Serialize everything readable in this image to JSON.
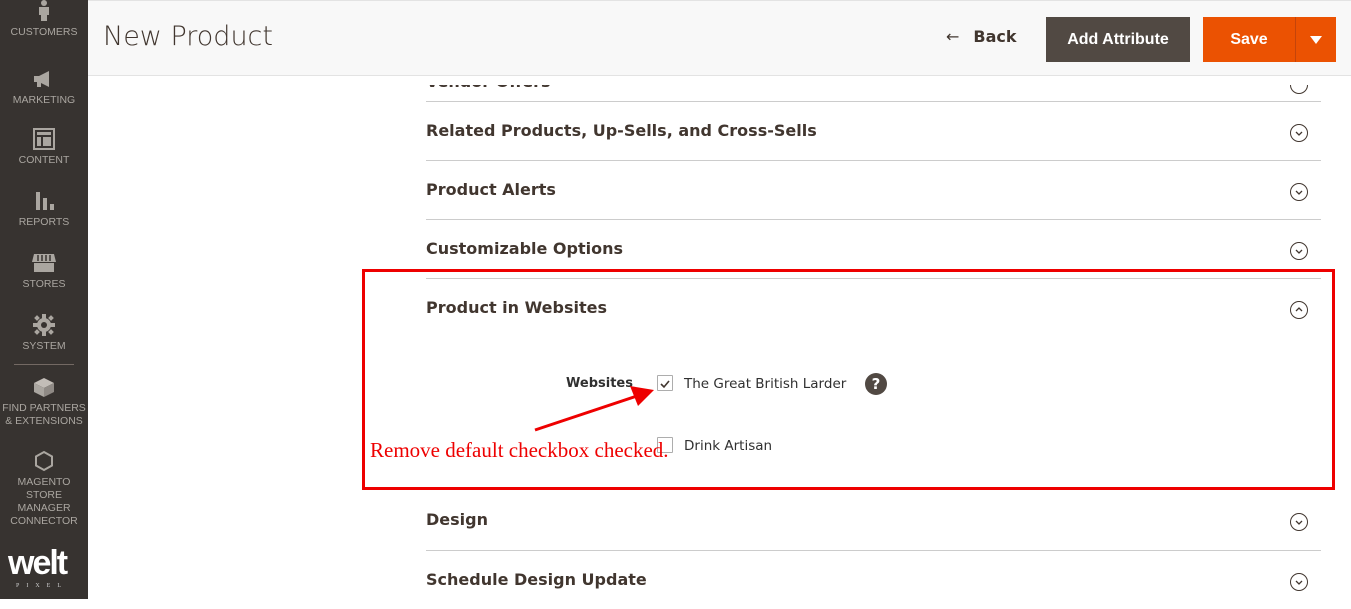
{
  "sidebar": {
    "items": [
      {
        "label": "CUSTOMERS",
        "icon": "customers-icon"
      },
      {
        "label": "MARKETING",
        "icon": "megaphone-icon"
      },
      {
        "label": "CONTENT",
        "icon": "content-icon"
      },
      {
        "label": "REPORTS",
        "icon": "reports-icon"
      },
      {
        "label": "STORES",
        "icon": "store-icon"
      },
      {
        "label": "SYSTEM",
        "icon": "gear-icon"
      },
      {
        "label": "FIND PARTNERS & EXTENSIONS",
        "icon": "brick-icon"
      },
      {
        "label": "MAGENTO STORE MANAGER CONNECTOR",
        "icon": "hexagon-icon"
      }
    ],
    "logo": "welt",
    "logo_sub": "PIXEL"
  },
  "header": {
    "title": "New Product",
    "back_label": "Back",
    "add_attribute_label": "Add Attribute",
    "save_label": "Save"
  },
  "sections": [
    {
      "title": "Vendor Offers",
      "expanded": false
    },
    {
      "title": "Related Products, Up-Sells, and Cross-Sells",
      "expanded": false
    },
    {
      "title": "Product Alerts",
      "expanded": false
    },
    {
      "title": "Customizable Options",
      "expanded": false
    },
    {
      "title": "Product in Websites",
      "expanded": true
    },
    {
      "title": "Design",
      "expanded": false
    },
    {
      "title": "Schedule Design Update",
      "expanded": false
    }
  ],
  "websites": {
    "label": "Websites",
    "options": [
      {
        "label": "The Great British Larder",
        "checked": true
      },
      {
        "label": "Drink Artisan",
        "checked": false
      }
    ],
    "help": "?"
  },
  "annotation": {
    "text": "Remove default checkbox checked.",
    "color": "#ee0000"
  },
  "colors": {
    "sidebar_bg": "#373330",
    "primary": "#eb5202",
    "secondary": "#514943"
  }
}
